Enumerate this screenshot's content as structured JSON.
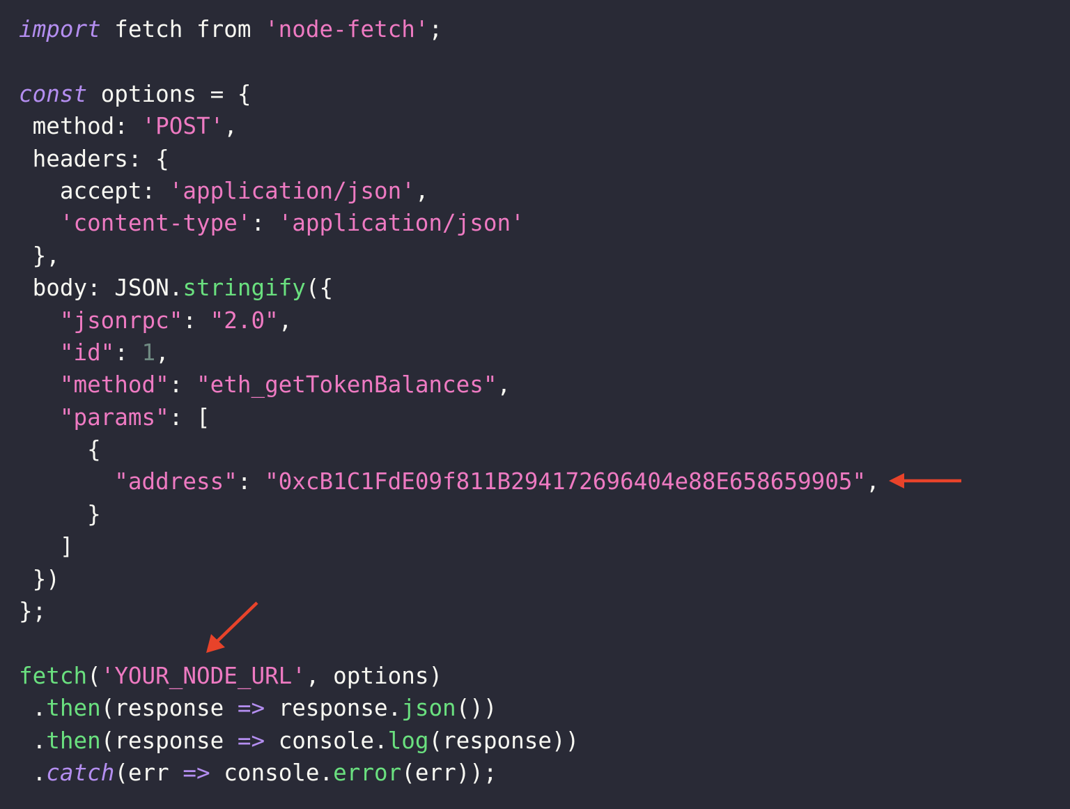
{
  "editor": {
    "theme": {
      "background": "#292a36",
      "keyword": "#b48ef0",
      "string": "#ee7ac2",
      "function": "#6ae07f",
      "number": "#6f8a82",
      "plain": "#f8f8f2",
      "annotation_arrow": "#e8432a"
    },
    "lines": [
      [
        {
          "t": "kw",
          "v": "import"
        },
        {
          "t": "pl",
          "v": " fetch from "
        },
        {
          "t": "str",
          "v": "'node-fetch'"
        },
        {
          "t": "pl",
          "v": ";"
        }
      ],
      [],
      [
        {
          "t": "kw",
          "v": "const"
        },
        {
          "t": "pl",
          "v": " options = {"
        }
      ],
      [
        {
          "t": "pl",
          "v": " method: "
        },
        {
          "t": "str",
          "v": "'POST'"
        },
        {
          "t": "pl",
          "v": ","
        }
      ],
      [
        {
          "t": "pl",
          "v": " headers: {"
        }
      ],
      [
        {
          "t": "pl",
          "v": "   accept: "
        },
        {
          "t": "str",
          "v": "'application/json'"
        },
        {
          "t": "pl",
          "v": ","
        }
      ],
      [
        {
          "t": "pl",
          "v": "   "
        },
        {
          "t": "str",
          "v": "'content-type'"
        },
        {
          "t": "pl",
          "v": ": "
        },
        {
          "t": "str",
          "v": "'application/json'"
        }
      ],
      [
        {
          "t": "pl",
          "v": " },"
        }
      ],
      [
        {
          "t": "pl",
          "v": " body: JSON."
        },
        {
          "t": "fn",
          "v": "stringify"
        },
        {
          "t": "pl",
          "v": "({"
        }
      ],
      [
        {
          "t": "pl",
          "v": "   "
        },
        {
          "t": "str",
          "v": "\"jsonrpc\""
        },
        {
          "t": "pl",
          "v": ": "
        },
        {
          "t": "str",
          "v": "\"2.0\""
        },
        {
          "t": "pl",
          "v": ","
        }
      ],
      [
        {
          "t": "pl",
          "v": "   "
        },
        {
          "t": "str",
          "v": "\"id\""
        },
        {
          "t": "pl",
          "v": ": "
        },
        {
          "t": "num",
          "v": "1"
        },
        {
          "t": "pl",
          "v": ","
        }
      ],
      [
        {
          "t": "pl",
          "v": "   "
        },
        {
          "t": "str",
          "v": "\"method\""
        },
        {
          "t": "pl",
          "v": ": "
        },
        {
          "t": "str",
          "v": "\"eth_getTokenBalances\""
        },
        {
          "t": "pl",
          "v": ","
        }
      ],
      [
        {
          "t": "pl",
          "v": "   "
        },
        {
          "t": "str",
          "v": "\"params\""
        },
        {
          "t": "pl",
          "v": ": ["
        }
      ],
      [
        {
          "t": "pl",
          "v": "     {"
        }
      ],
      [
        {
          "t": "pl",
          "v": "       "
        },
        {
          "t": "str",
          "v": "\"address\""
        },
        {
          "t": "pl",
          "v": ": "
        },
        {
          "t": "str",
          "v": "\"0xcB1C1FdE09f811B294172696404e88E658659905\""
        },
        {
          "t": "pl",
          "v": ","
        }
      ],
      [
        {
          "t": "pl",
          "v": "     }"
        }
      ],
      [
        {
          "t": "pl",
          "v": "   ]"
        }
      ],
      [
        {
          "t": "pl",
          "v": " })"
        }
      ],
      [
        {
          "t": "pl",
          "v": "};"
        }
      ],
      [],
      [
        {
          "t": "fn",
          "v": "fetch"
        },
        {
          "t": "pl",
          "v": "("
        },
        {
          "t": "str",
          "v": "'YOUR_NODE_URL'"
        },
        {
          "t": "pl",
          "v": ", options)"
        }
      ],
      [
        {
          "t": "pl",
          "v": " ."
        },
        {
          "t": "fn",
          "v": "then"
        },
        {
          "t": "pl",
          "v": "(response "
        },
        {
          "t": "op",
          "v": "=>"
        },
        {
          "t": "pl",
          "v": " response."
        },
        {
          "t": "fn",
          "v": "json"
        },
        {
          "t": "pl",
          "v": "())"
        }
      ],
      [
        {
          "t": "pl",
          "v": " ."
        },
        {
          "t": "fn",
          "v": "then"
        },
        {
          "t": "pl",
          "v": "(response "
        },
        {
          "t": "op",
          "v": "=>"
        },
        {
          "t": "pl",
          "v": " console."
        },
        {
          "t": "fn",
          "v": "log"
        },
        {
          "t": "pl",
          "v": "(response))"
        }
      ],
      [
        {
          "t": "pl",
          "v": " ."
        },
        {
          "t": "kw",
          "v": "catch"
        },
        {
          "t": "pl",
          "v": "(err "
        },
        {
          "t": "op",
          "v": "=>"
        },
        {
          "t": "pl",
          "v": " console."
        },
        {
          "t": "fn",
          "v": "error"
        },
        {
          "t": "pl",
          "v": "(err));"
        }
      ]
    ],
    "annotations": [
      {
        "name": "address-arrow",
        "icon": "arrow-left-icon",
        "points_to": "address value"
      },
      {
        "name": "node-url-arrow",
        "icon": "arrow-down-left-icon",
        "points_to": "YOUR_NODE_URL"
      }
    ]
  }
}
